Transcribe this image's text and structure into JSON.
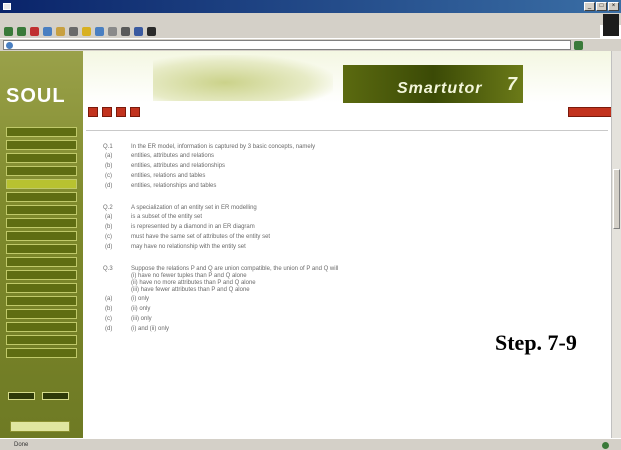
{
  "window": {
    "title": ""
  },
  "menubar": {
    "items": [
      "",
      "",
      "",
      "",
      "",
      ""
    ]
  },
  "address": {
    "value": ""
  },
  "sidebar": {
    "logo": "SOUL",
    "items": [
      "",
      "",
      "",
      "",
      "",
      "",
      "",
      "",
      "",
      "",
      "",
      "",
      "",
      "",
      "",
      "",
      "",
      "",
      "",
      "",
      "",
      ""
    ],
    "logout": ""
  },
  "banner": {
    "product": "Smartutor",
    "number": "7"
  },
  "nav": {
    "tabs": [
      "",
      "",
      "",
      ""
    ],
    "link": "",
    "logout": "",
    "breadcrumb": ""
  },
  "questions": [
    {
      "number": "Q.1",
      "text": "In the ER model, information is captured by 3 basic concepts, namely",
      "extra": [],
      "options": [
        {
          "mark": "(a)",
          "text": "entities, attributes and relations"
        },
        {
          "mark": "(b)",
          "text": "entities, attributes and relationships"
        },
        {
          "mark": "(c)",
          "text": "entities, relations and tables"
        },
        {
          "mark": "(d)",
          "text": "entities, relationships and tables"
        }
      ]
    },
    {
      "number": "Q.2",
      "text": "A specialization of an entity set in ER modelling",
      "extra": [],
      "options": [
        {
          "mark": "(a)",
          "text": "is a subset of the entity set"
        },
        {
          "mark": "(b)",
          "text": "is represented by a diamond in an ER diagram"
        },
        {
          "mark": "(c)",
          "text": "must have the same set of attributes of the entity set"
        },
        {
          "mark": "(d)",
          "text": "may have no relationship with the entity set"
        }
      ]
    },
    {
      "number": "Q.3",
      "text": "Suppose the relations P and Q are union compatible, the union of P and Q will",
      "extra": [
        "(i) have no fewer tuples than P and Q alone",
        "(ii) have no more attributes than P and Q alone",
        "(iii) have fewer attributes than P and Q alone"
      ],
      "options": [
        {
          "mark": "(a)",
          "text": "(i) only"
        },
        {
          "mark": "(b)",
          "text": "(ii) only"
        },
        {
          "mark": "(c)",
          "text": "(iii) only"
        },
        {
          "mark": "(d)",
          "text": "(i) and (ii) only"
        }
      ]
    }
  ],
  "overlay": {
    "step": "Step. 7-9"
  },
  "statusbar": {
    "text": "Done",
    "zone": ""
  },
  "colors": {
    "sidebar": "#7f8a2c",
    "tab": "#c2331e",
    "banner": "#3b4a06"
  }
}
